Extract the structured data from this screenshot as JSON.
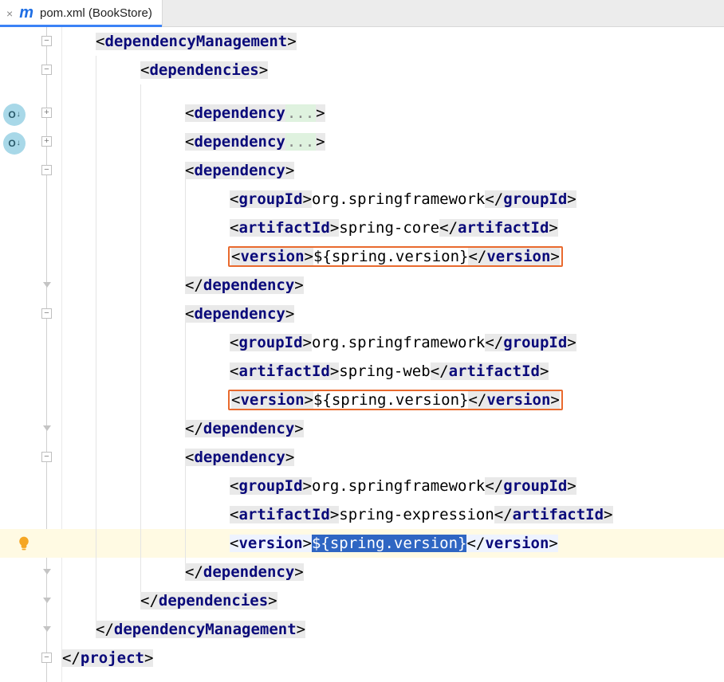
{
  "tab": {
    "title": "pom.xml (BookStore)",
    "icon": "m"
  },
  "gutter": {
    "override_badges": [
      "O↓",
      "O↓"
    ]
  },
  "xml": {
    "dependencyManagement": "dependencyManagement",
    "dependencies": "dependencies",
    "dependency": "dependency",
    "groupId": "groupId",
    "artifactId": "artifactId",
    "version": "version",
    "project": "project",
    "ellipsis": "..."
  },
  "values": {
    "org_spring": "org.springframework",
    "spring_core": "spring-core",
    "spring_web": "spring-web",
    "spring_expression": "spring-expression",
    "spring_version_expr": "${spring.version}"
  }
}
